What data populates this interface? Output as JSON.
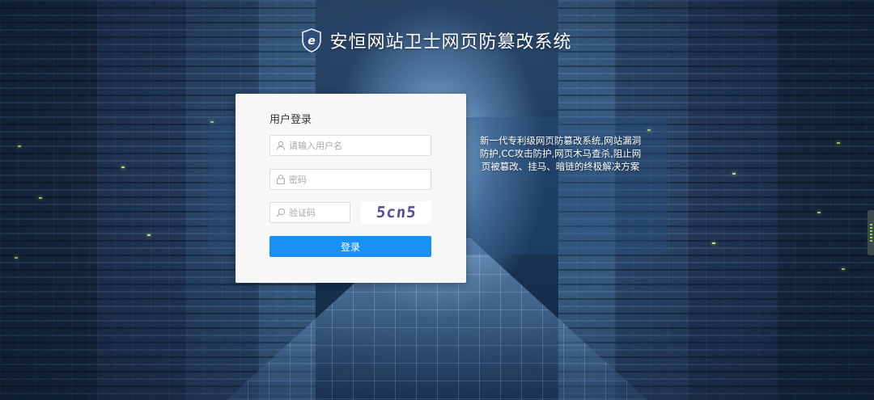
{
  "header": {
    "title": "安恒网站卫士网页防篡改系统",
    "logo_letter": "e"
  },
  "login": {
    "title": "用户登录",
    "username_placeholder": "请输入用户名",
    "password_placeholder": "密码",
    "captcha_placeholder": "验证码",
    "captcha_text": "5cn5",
    "submit_label": "登录"
  },
  "info": {
    "text": "新一代专利级网页防篡改系统,网站漏洞防护,CC攻击防护,网页木马查杀,阻止网页被篡改、挂马、暗链的终极解决方案"
  },
  "colors": {
    "accent": "#1890f5",
    "card_bg": "#f7f7f7",
    "title_text": "#ffffff"
  },
  "icons": {
    "logo": "shield-e-icon",
    "username": "user-icon",
    "password": "lock-icon",
    "captcha": "search-icon"
  }
}
